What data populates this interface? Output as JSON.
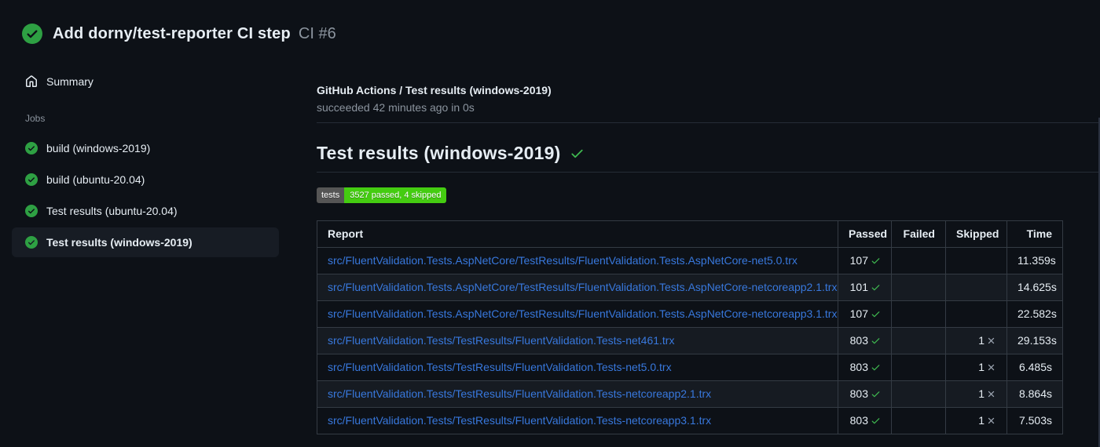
{
  "header": {
    "title": "Add dorny/test-reporter CI step",
    "run_number": "CI #6",
    "status_icon": "check-circle-icon"
  },
  "sidebar": {
    "summary_label": "Summary",
    "jobs_label": "Jobs",
    "jobs": [
      {
        "label": "build (windows-2019)",
        "selected": false
      },
      {
        "label": "build (ubuntu-20.04)",
        "selected": false
      },
      {
        "label": "Test results (ubuntu-20.04)",
        "selected": false
      },
      {
        "label": "Test results (windows-2019)",
        "selected": true
      }
    ]
  },
  "main": {
    "check_title": "GitHub Actions / Test results (windows-2019)",
    "status_line": "succeeded 42 minutes ago in 0s",
    "heading": "Test results (windows-2019)",
    "badge": {
      "label": "tests",
      "value": "3527 passed, 4 skipped"
    },
    "table": {
      "headers": [
        "Report",
        "Passed",
        "Failed",
        "Skipped",
        "Time"
      ],
      "rows": [
        {
          "report": "src/FluentValidation.Tests.AspNetCore/TestResults/FluentValidation.Tests.AspNetCore-net5.0.trx",
          "passed": "107",
          "failed": "",
          "skipped": "",
          "time": "11.359s"
        },
        {
          "report": "src/FluentValidation.Tests.AspNetCore/TestResults/FluentValidation.Tests.AspNetCore-netcoreapp2.1.trx",
          "passed": "101",
          "failed": "",
          "skipped": "",
          "time": "14.625s"
        },
        {
          "report": "src/FluentValidation.Tests.AspNetCore/TestResults/FluentValidation.Tests.AspNetCore-netcoreapp3.1.trx",
          "passed": "107",
          "failed": "",
          "skipped": "",
          "time": "22.582s"
        },
        {
          "report": "src/FluentValidation.Tests/TestResults/FluentValidation.Tests-net461.trx",
          "passed": "803",
          "failed": "",
          "skipped": "1",
          "time": "29.153s"
        },
        {
          "report": "src/FluentValidation.Tests/TestResults/FluentValidation.Tests-net5.0.trx",
          "passed": "803",
          "failed": "",
          "skipped": "1",
          "time": "6.485s"
        },
        {
          "report": "src/FluentValidation.Tests/TestResults/FluentValidation.Tests-netcoreapp2.1.trx",
          "passed": "803",
          "failed": "",
          "skipped": "1",
          "time": "8.864s"
        },
        {
          "report": "src/FluentValidation.Tests/TestResults/FluentValidation.Tests-netcoreapp3.1.trx",
          "passed": "803",
          "failed": "",
          "skipped": "1",
          "time": "7.503s"
        }
      ]
    }
  },
  "colors": {
    "page_bg": "#0d1117",
    "text_primary": "#e6edf3",
    "text_muted": "#8b949e",
    "link_blue": "#3878dd",
    "green_circle": "#2ea043",
    "check_green": "#3fb950",
    "x_gray": "#9ea7b3",
    "border": "#343b44",
    "row_alt_bg": "#161b22",
    "selected_bg": "#171c24",
    "badge_label_bg": "#555555",
    "badge_value_bg": "#44cc11"
  }
}
